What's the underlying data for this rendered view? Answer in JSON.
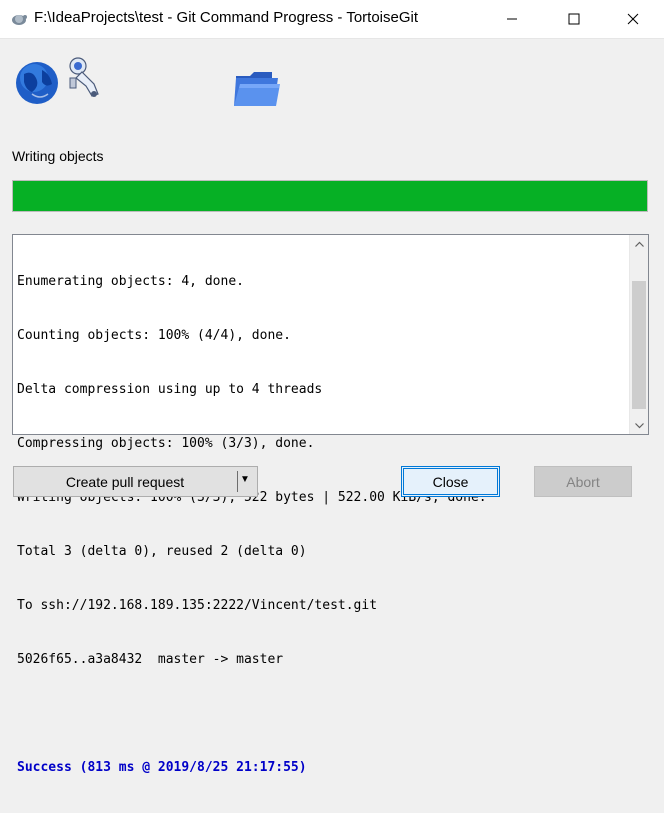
{
  "window": {
    "title": "F:\\IdeaProjects\\test - Git Command Progress - TortoiseGit",
    "app_icon": "tortoisegit-icon",
    "controls": [
      "minimize-icon",
      "maximize-icon",
      "close-icon"
    ]
  },
  "icons": [
    "globe-icon",
    "astronaut-icon",
    "folder-icon"
  ],
  "status": {
    "label": "Writing objects",
    "progress_percent": 100,
    "progress_color": "#06b025"
  },
  "log": {
    "lines": [
      "Enumerating objects: 4, done.",
      "Counting objects: 100% (4/4), done.",
      "Delta compression using up to 4 threads",
      "Compressing objects: 100% (3/3), done.",
      "Writing objects: 100% (3/3), 522 bytes | 522.00 KiB/s, done.",
      "Total 3 (delta 0), reused 2 (delta 0)",
      "To ssh://192.168.189.135:2222/Vincent/test.git",
      "5026f65..a3a8432  master -> master",
      "",
      "Success (813 ms @ 2019/8/25 21:17:55)"
    ],
    "success_color": "#0000c8"
  },
  "buttons": {
    "pull_request": "Create pull request",
    "close": "Close",
    "abort": "Abort"
  }
}
